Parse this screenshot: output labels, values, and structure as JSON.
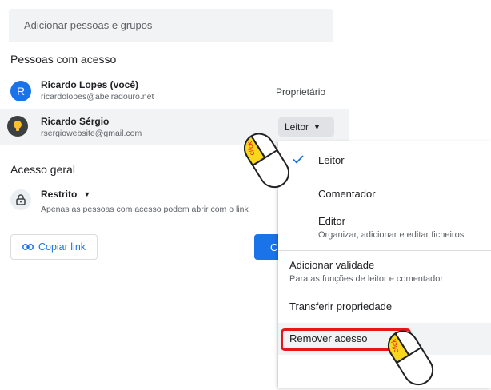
{
  "search": {
    "placeholder": "Adicionar pessoas e grupos"
  },
  "people_section": {
    "title": "Pessoas com acesso"
  },
  "people": [
    {
      "initial": "R",
      "name": "Ricardo Lopes (você)",
      "email": "ricardolopes@abeiradouro.net",
      "role": "Proprietário",
      "avatar_color": "#1a73e8"
    },
    {
      "name": "Ricardo Sérgio",
      "email": "rsergiowebsite@gmail.com",
      "role": "Leitor",
      "avatar_color": "#3c4043"
    }
  ],
  "general_access": {
    "title": "Acesso geral",
    "mode": "Restrito",
    "description": "Apenas as pessoas com acesso podem abrir com o link"
  },
  "buttons": {
    "copy_link": "Copiar link",
    "done": "Co"
  },
  "menu": {
    "items": [
      {
        "label": "Leitor",
        "checked": true
      },
      {
        "label": "Comentador"
      },
      {
        "label": "Editor",
        "sub": "Organizar, adicionar e editar ficheiros"
      },
      {
        "label": "Adicionar validade",
        "sub": "Para as funções de leitor e comentador"
      },
      {
        "label": "Transferir propriedade"
      },
      {
        "label": "Remover acesso",
        "highlighted": true
      }
    ]
  },
  "cursor_label": "click",
  "colors": {
    "accent": "#1a73e8",
    "highlight_red": "#e8161b",
    "mouse_yellow": "#f9d71c"
  }
}
